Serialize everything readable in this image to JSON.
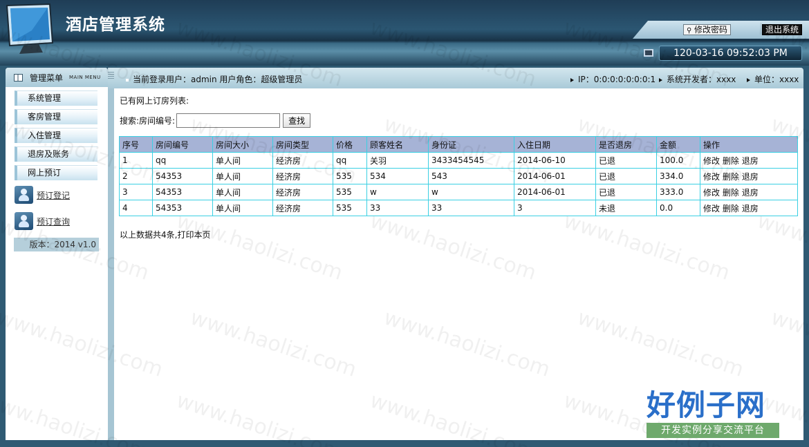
{
  "header": {
    "title": "酒店管理系统",
    "change_password": "修改密码",
    "logout": "退出系统",
    "datetime": "120-03-16 09:52:03 PM"
  },
  "sidebar": {
    "title": "管理菜单",
    "subtitle": "MAIN MENU",
    "items": [
      {
        "label": "系统管理"
      },
      {
        "label": "客房管理"
      },
      {
        "label": "入住管理"
      },
      {
        "label": "退房及账务"
      },
      {
        "label": "网上预订"
      }
    ],
    "links": [
      {
        "label": "预订登记"
      },
      {
        "label": "预订查询"
      }
    ],
    "version": "版本：2014 v1.0"
  },
  "topbar": {
    "user_info": "当前登录用户：admin  用户角色：超级管理员",
    "ip": "IP：0:0:0:0:0:0:0:1",
    "developer": "系统开发者：xxxx",
    "unit": "单位：xxxx"
  },
  "content": {
    "list_title": "已有网上订房列表:",
    "search_label": "搜索:房间编号:",
    "search_value": "",
    "search_button": "查找",
    "columns": [
      "序号",
      "房间编号",
      "房间大小",
      "房间类型",
      "价格",
      "顾客姓名",
      "身份证",
      "入住日期",
      "是否退房",
      "金额",
      "操作"
    ],
    "rows": [
      [
        "1",
        "qq",
        "单人间",
        "经济房",
        "qq",
        "关羽",
        "3433454545",
        "2014-06-10",
        "已退",
        "100.0"
      ],
      [
        "2",
        "54353",
        "单人间",
        "经济房",
        "535",
        "534",
        "543",
        "2014-06-01",
        "已退",
        "334.0"
      ],
      [
        "3",
        "54353",
        "单人间",
        "经济房",
        "535",
        "w",
        "w",
        "2014-06-01",
        "已退",
        "333.0"
      ],
      [
        "4",
        "54353",
        "单人间",
        "经济房",
        "535",
        "33",
        "33",
        "3",
        "未退",
        "0.0"
      ]
    ],
    "actions": {
      "edit": "修改",
      "delete": "删除",
      "checkout": "退房"
    },
    "summary": "以上数据共4条,打印本页"
  },
  "watermark": {
    "text": "www.haolizi.com",
    "brand": "好例子网",
    "brand_sub": "开发实例分享交流平台"
  },
  "colors": {
    "header_dark": "#1f3d56",
    "table_border": "#3ad0e3",
    "table_header_bg": "#a6b3d6",
    "brand_blue": "#2a6fc9",
    "brand_green": "#6ea96c"
  }
}
